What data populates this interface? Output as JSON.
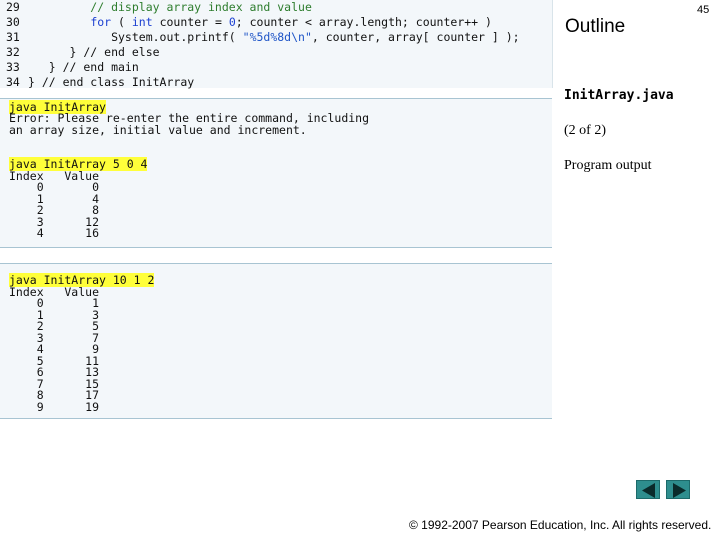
{
  "slide": {
    "page_number": "45",
    "outline_title": "Outline",
    "filename": "InitArray.java",
    "page_of": "(2 of 2)",
    "caption": "Program output",
    "copyright": "© 1992-2007 Pearson Education, Inc.  All rights reserved."
  },
  "code": {
    "lines": [
      {
        "num": "29",
        "code": "         // display array index and value"
      },
      {
        "num": "30",
        "code": "         for ( int counter = 0; counter < array.length; counter++ )"
      },
      {
        "num": "31",
        "code": "            System.out.printf( \"%5d%8d\\n\", counter, array[ counter ] );"
      },
      {
        "num": "32",
        "code": "      } // end else"
      },
      {
        "num": "33",
        "code": "   } // end main"
      },
      {
        "num": "34",
        "code": "} // end class InitArray"
      }
    ]
  },
  "outputs": {
    "run0": {
      "command": "java InitArray",
      "text": "Error: Please re-enter the entire command, including\nan array size, initial value and increment."
    },
    "run1": {
      "command": "java InitArray 5 0 4",
      "text": "Index   Value\n    0       0\n    1       4\n    2       8\n    3      12\n    4      16"
    },
    "run2": {
      "command": "java InitArray 10 1 2",
      "text": "Index   Value\n    0       1\n    1       3\n    2       5\n    3       7\n    4       9\n    5      11\n    6      13\n    7      15\n    8      17\n    9      19"
    }
  },
  "nav": {
    "prev_icon": "triangle-left-icon",
    "next_icon": "triangle-right-icon"
  },
  "colors": {
    "panel_bg": "#f3f7fa",
    "command_highlight": "#ffff3a",
    "nav_button": "#2e8e8e",
    "keyword": "#1b3fd1",
    "comment": "#2e7d2e"
  }
}
